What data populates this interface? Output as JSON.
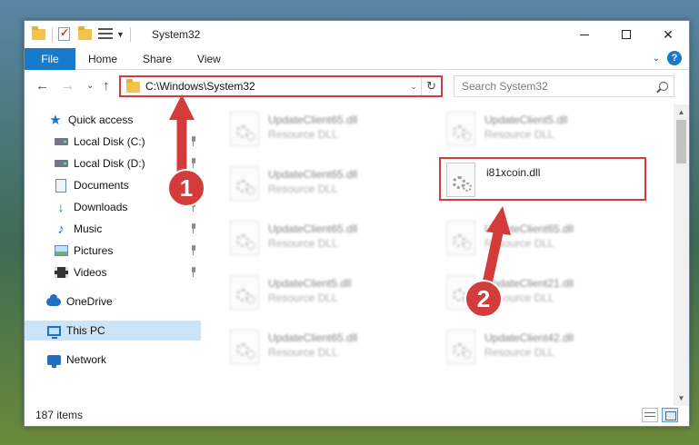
{
  "window": {
    "title": "System32",
    "controls": {
      "minimize": "",
      "maximize": "",
      "close": "✕"
    }
  },
  "ribbon": {
    "file_tab": "File",
    "tabs": [
      "Home",
      "Share",
      "View"
    ],
    "expand_chevron": "⌄",
    "help": "?"
  },
  "navigation": {
    "back": "←",
    "forward": "→",
    "recent": "⌄",
    "up": "↑"
  },
  "address": {
    "path": "C:\\Windows\\System32",
    "dropdown": "⌄",
    "refresh": "↻"
  },
  "search": {
    "placeholder": "Search System32"
  },
  "sidebar": {
    "items": [
      {
        "label": "Quick access",
        "icon": "star-icon"
      },
      {
        "label": "Local Disk (C:)",
        "icon": "drive-icon",
        "pinned": true
      },
      {
        "label": "Local Disk (D:)",
        "icon": "drive-icon",
        "pinned": true
      },
      {
        "label": "Documents",
        "icon": "documents-icon",
        "pinned": true
      },
      {
        "label": "Downloads",
        "icon": "downloads-icon",
        "pinned": true
      },
      {
        "label": "Music",
        "icon": "music-icon",
        "pinned": true
      },
      {
        "label": "Pictures",
        "icon": "pictures-icon",
        "pinned": true
      },
      {
        "label": "Videos",
        "icon": "videos-icon",
        "pinned": true
      },
      {
        "label": "OneDrive",
        "icon": "onedrive-icon"
      },
      {
        "label": "This PC",
        "icon": "this-pc-icon",
        "selected": true
      },
      {
        "label": "Network",
        "icon": "network-icon"
      }
    ]
  },
  "files": [
    {
      "name": "UpdateClient65.dll",
      "type": "Resource DLL",
      "blurred": true
    },
    {
      "name": "UpdateClient5.dll",
      "type": "Resource DLL",
      "blurred": true
    },
    {
      "name": "UpdateClient65.dll",
      "type": "Resource DLL",
      "blurred": true
    },
    {
      "name": "i81xcoin.dll",
      "type": "",
      "highlighted": true
    },
    {
      "name": "UpdateClient65.dll",
      "type": "Resource DLL",
      "blurred": true
    },
    {
      "name": "UpdateClient65.dll",
      "type": "Resource DLL",
      "blurred": true
    },
    {
      "name": "UpdateClient5.dll",
      "type": "Resource DLL",
      "blurred": true
    },
    {
      "name": "UpdateClient21.dll",
      "type": "Resource DLL",
      "blurred": true
    },
    {
      "name": "UpdateClient65.dll",
      "type": "Resource DLL",
      "blurred": true
    },
    {
      "name": "UpdateClient42.dll",
      "type": "Resource DLL",
      "blurred": true
    }
  ],
  "status": {
    "item_count": "187 items"
  },
  "annotations": {
    "steps": [
      "1",
      "2"
    ],
    "color": "#d43c3c"
  },
  "colors": {
    "accent": "#1979ca",
    "highlight_border": "#d43c3c",
    "selected_bg": "#cce4f7"
  }
}
